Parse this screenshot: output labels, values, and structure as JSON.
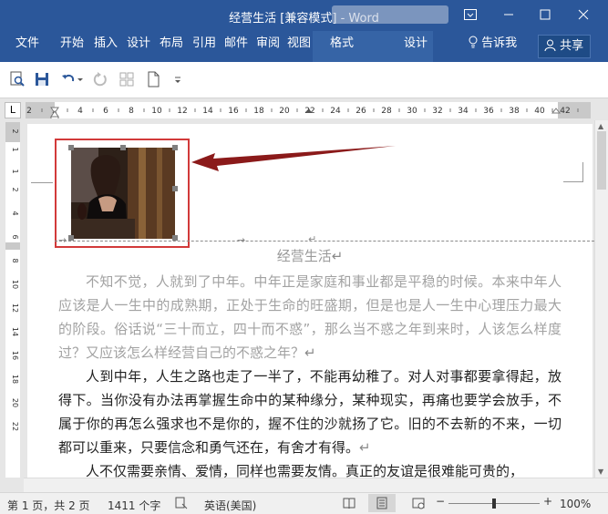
{
  "window": {
    "title": "经营生活 [兼容模式]  -  Word",
    "controls": [
      "ribbon-display-icon",
      "minimize-icon",
      "maximize-icon",
      "close-icon"
    ]
  },
  "ribbon": {
    "tabs": [
      "文件",
      "开始",
      "插入",
      "设计",
      "布局",
      "引用",
      "邮件",
      "审阅",
      "视图"
    ],
    "contextual_tabs": [
      "格式",
      "设计"
    ],
    "tell_me": "告诉我",
    "share": "共享"
  },
  "quick_access": {
    "icons": [
      "print-preview-icon",
      "save-icon",
      "undo-icon",
      "redo-icon",
      "touch-mode-icon",
      "new-document-icon",
      "customize-dropdown-icon"
    ]
  },
  "ruler": {
    "corner": "L",
    "horizontal_labels": [
      "2",
      "2",
      "4",
      "6",
      "8",
      "10",
      "12",
      "14",
      "16",
      "18",
      "20",
      "22",
      "24",
      "26",
      "28",
      "30",
      "32",
      "34",
      "36",
      "38",
      "40",
      "42"
    ],
    "vertical_labels": [
      "2",
      "1",
      "1",
      "2",
      "4",
      "6",
      "8",
      "10",
      "12",
      "14",
      "16",
      "18",
      "20",
      "22"
    ]
  },
  "document": {
    "title": "经营生活",
    "paragraphs": [
      {
        "style": "faded",
        "text": "不知不觉，人就到了中年。中年正是家庭和事业都是平稳的时候。本来中年人应该是人一生中的成熟期，正处于生命的旺盛期，但是也是人一生中心理压力最大的阶段。俗话说“三十而立，四十而不惑”，那么当不惑之年到来时，人该怎么样度过？又应该怎么样经营自己的不惑之年？"
      },
      {
        "style": "normal",
        "text": "人到中年，人生之路也走了一半了，不能再幼稚了。对人对事都要拿得起，放得下。当你没有办法再掌握生命中的某种缘分，某种现实，再痛也要学会放手，不属于你的再怎么强求也不是你的，握不住的沙就扬了它。旧的不去新的不来，一切都可以重来，只要信念和勇气还在，有舍才有得。"
      },
      {
        "style": "normal",
        "text": "人不仅需要亲情、爱情，同样也需要友情。真正的友谊是很难能可贵的，"
      }
    ],
    "paragraph_mark": "↵"
  },
  "status_bar": {
    "page": "第 1 页，共 2 页",
    "words": "1411 个字",
    "language": "英语(美国)",
    "zoom": "100%",
    "minus": "−",
    "plus": "+"
  },
  "colors": {
    "brand": "#2b579a",
    "highlight_box": "#d23a3a",
    "arrow": "#8b1a1a"
  }
}
